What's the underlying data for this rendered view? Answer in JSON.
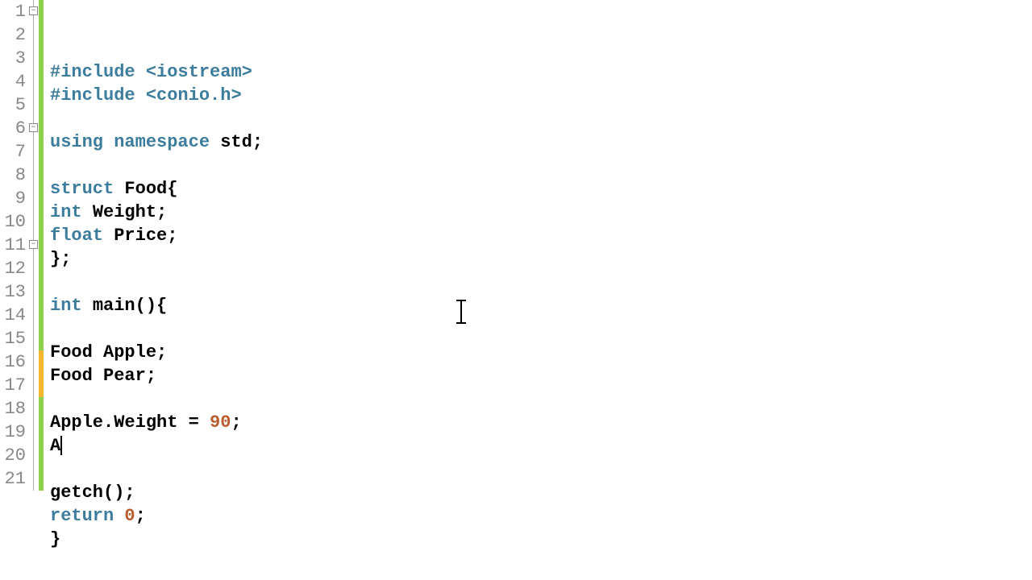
{
  "lines": [
    {
      "num": "1",
      "fold": "box",
      "change": "saved",
      "tokens": [
        [
          "preproc",
          "#include "
        ],
        [
          "angle",
          "<iostream>"
        ]
      ]
    },
    {
      "num": "2",
      "fold": "bar",
      "change": "saved",
      "tokens": [
        [
          "preproc",
          "#include "
        ],
        [
          "angle",
          "<conio.h>"
        ]
      ]
    },
    {
      "num": "3",
      "fold": "bar",
      "change": "saved",
      "tokens": []
    },
    {
      "num": "4",
      "fold": "bar",
      "change": "saved",
      "tokens": [
        [
          "keyword",
          "using namespace "
        ],
        [
          "ident",
          "std"
        ],
        [
          "punct",
          ";"
        ]
      ]
    },
    {
      "num": "5",
      "fold": "bar",
      "change": "saved",
      "tokens": []
    },
    {
      "num": "6",
      "fold": "box",
      "change": "saved",
      "tokens": [
        [
          "keyword",
          "struct "
        ],
        [
          "ident",
          "Food"
        ],
        [
          "punct",
          "{"
        ]
      ]
    },
    {
      "num": "7",
      "fold": "bar",
      "change": "saved",
      "tokens": [
        [
          "type",
          "int "
        ],
        [
          "ident",
          "Weight"
        ],
        [
          "punct",
          ";"
        ]
      ]
    },
    {
      "num": "8",
      "fold": "bar",
      "change": "saved",
      "tokens": [
        [
          "type",
          "float "
        ],
        [
          "ident",
          "Price"
        ],
        [
          "punct",
          ";"
        ]
      ]
    },
    {
      "num": "9",
      "fold": "bar",
      "change": "saved",
      "tokens": [
        [
          "punct",
          "};"
        ]
      ]
    },
    {
      "num": "10",
      "fold": "bar",
      "change": "saved",
      "tokens": []
    },
    {
      "num": "11",
      "fold": "box",
      "change": "saved",
      "tokens": [
        [
          "type",
          "int "
        ],
        [
          "ident",
          "main"
        ],
        [
          "punct",
          "(){"
        ]
      ]
    },
    {
      "num": "12",
      "fold": "bar",
      "change": "saved",
      "tokens": []
    },
    {
      "num": "13",
      "fold": "bar",
      "change": "saved",
      "tokens": [
        [
          "ident",
          "Food Apple"
        ],
        [
          "punct",
          ";"
        ]
      ]
    },
    {
      "num": "14",
      "fold": "bar",
      "change": "saved",
      "tokens": [
        [
          "ident",
          "Food Pear"
        ],
        [
          "punct",
          ";"
        ]
      ]
    },
    {
      "num": "15",
      "fold": "bar",
      "change": "saved",
      "tokens": []
    },
    {
      "num": "16",
      "fold": "bar",
      "change": "mod",
      "tokens": [
        [
          "ident",
          "Apple"
        ],
        [
          "punct",
          "."
        ],
        [
          "ident",
          "Weight "
        ],
        [
          "punct",
          "= "
        ],
        [
          "num",
          "90"
        ],
        [
          "punct",
          ";"
        ]
      ]
    },
    {
      "num": "17",
      "fold": "bar",
      "change": "mod",
      "tokens": [
        [
          "ident",
          "A"
        ]
      ],
      "cursor": true
    },
    {
      "num": "18",
      "fold": "bar",
      "change": "saved",
      "tokens": []
    },
    {
      "num": "19",
      "fold": "bar",
      "change": "saved",
      "tokens": [
        [
          "ident",
          "getch"
        ],
        [
          "punct",
          "();"
        ]
      ]
    },
    {
      "num": "20",
      "fold": "bar",
      "change": "saved",
      "tokens": [
        [
          "keyword",
          "return "
        ],
        [
          "num",
          "0"
        ],
        [
          "punct",
          ";"
        ]
      ]
    },
    {
      "num": "21",
      "fold": "bar",
      "change": "saved",
      "tokens": [
        [
          "punct",
          "}"
        ]
      ]
    }
  ],
  "foldbox_glyph": "−"
}
